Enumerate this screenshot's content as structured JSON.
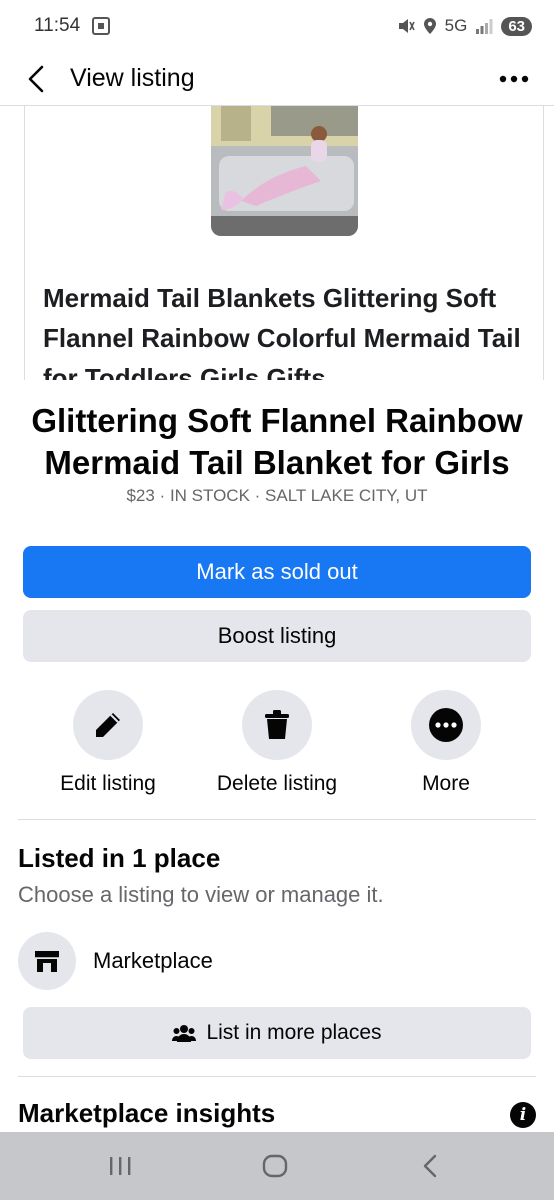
{
  "status_bar": {
    "time": "11:54",
    "network": "5G",
    "battery": "63"
  },
  "header": {
    "title": "View listing"
  },
  "preview": {
    "title_text": "Mermaid Tail Blankets Glittering Soft Flannel Rainbow Colorful Mermaid Tail for Toddlers Girls Gifts"
  },
  "listing": {
    "title": "Glittering Soft Flannel Rainbow Mermaid Tail Blanket for Girls",
    "subline": "$23 · IN STOCK · SALT LAKE CITY, UT"
  },
  "buttons": {
    "mark_sold": "Mark as sold out",
    "boost": "Boost listing",
    "list_more": "List in more places"
  },
  "actions": {
    "edit": "Edit listing",
    "delete": "Delete listing",
    "more": "More"
  },
  "listed": {
    "title": "Listed in 1 place",
    "subtitle": "Choose a listing to view or manage it.",
    "place": "Marketplace"
  },
  "insights": {
    "title": "Marketplace insights"
  },
  "colors": {
    "primary": "#1877f2",
    "secondary_bg": "#e4e6eb",
    "muted_text": "#65676b",
    "nav_bar": "#c6c7cb"
  },
  "icons": {
    "back": "back-arrow-icon",
    "more": "more-dots-icon",
    "edit": "pencil-icon",
    "delete": "trash-icon",
    "more_action": "more-circle-icon",
    "place": "storefront-icon",
    "list_more": "people-icon",
    "info": "info-icon"
  }
}
